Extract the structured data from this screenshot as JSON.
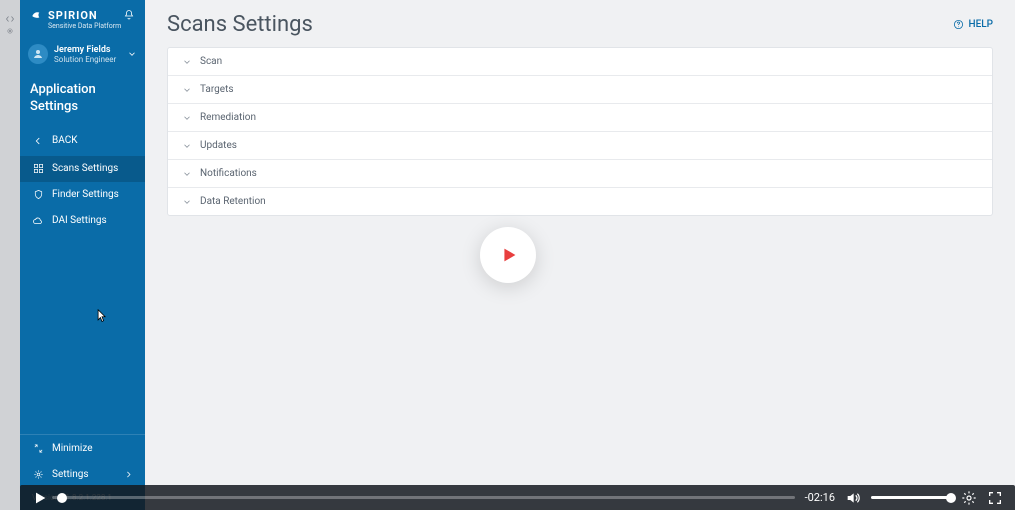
{
  "brand": {
    "name": "SPIRION",
    "tagline": "Sensitive Data Platform"
  },
  "user": {
    "name": "Jeremy Fields",
    "role": "Solution Engineer"
  },
  "section": {
    "title": "Application Settings"
  },
  "nav": {
    "back": "BACK",
    "items": [
      {
        "label": "Scans Settings"
      },
      {
        "label": "Finder Settings"
      },
      {
        "label": "DAI Settings"
      }
    ],
    "bottom": [
      {
        "label": "Minimize"
      },
      {
        "label": "Settings"
      }
    ],
    "version": "Version 11.8.2.1.228.1"
  },
  "page": {
    "title": "Scans Settings",
    "help": "HELP"
  },
  "accordion": [
    {
      "label": "Scan"
    },
    {
      "label": "Targets"
    },
    {
      "label": "Remediation"
    },
    {
      "label": "Updates"
    },
    {
      "label": "Notifications"
    },
    {
      "label": "Data Retention"
    }
  ],
  "video": {
    "time_remaining": "-02:16"
  },
  "colors": {
    "sidebar": "#0a6ca8",
    "sidebar_active": "#085a8c",
    "accent_red": "#e83f3f"
  }
}
